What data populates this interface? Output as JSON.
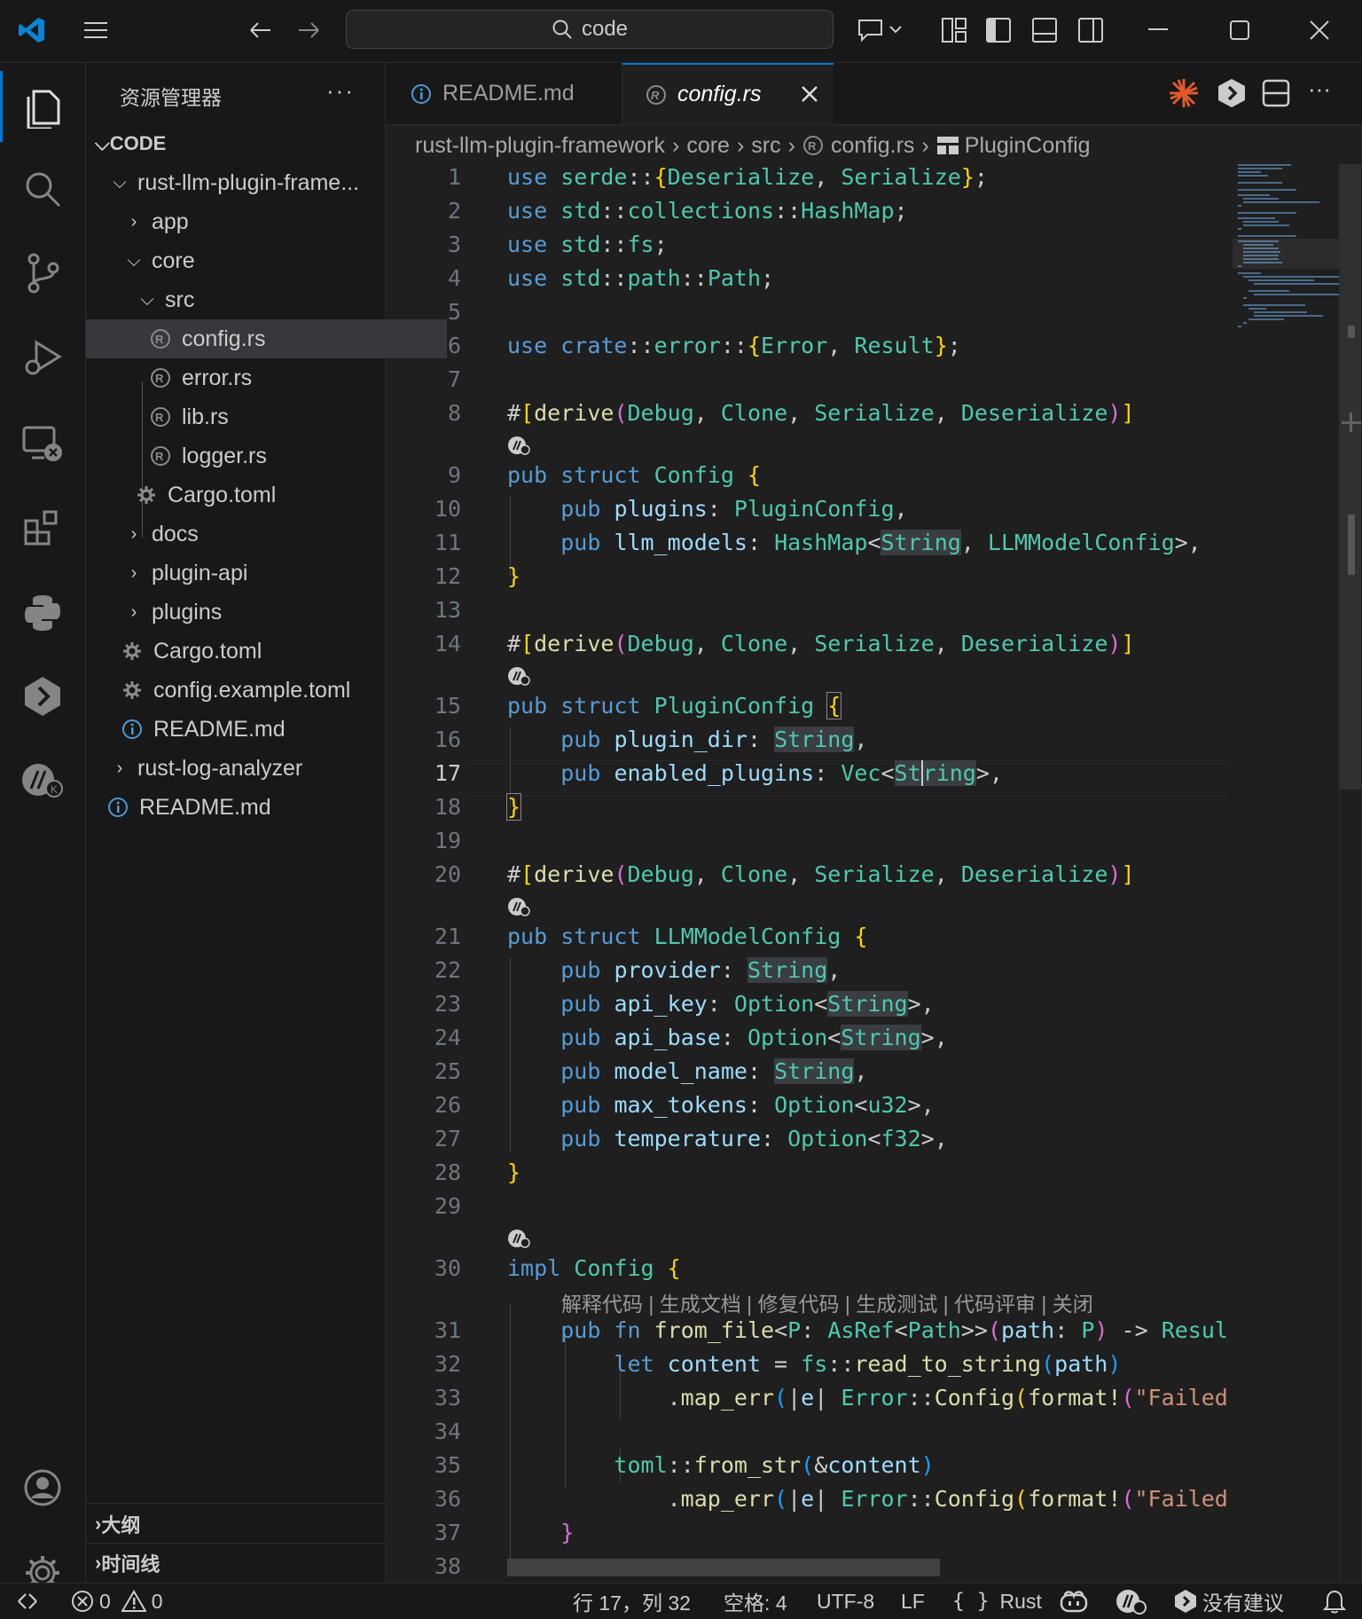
{
  "titlebar": {
    "search_text": "code"
  },
  "sidebar": {
    "title": "资源管理器",
    "more": "···",
    "root": "CODE",
    "tree": [
      {
        "label": "rust-llm-plugin-frame...",
        "kind": "folder-open"
      },
      {
        "label": "app",
        "kind": "folder"
      },
      {
        "label": "core",
        "kind": "folder-open"
      },
      {
        "label": "src",
        "kind": "folder-open"
      },
      {
        "label": "config.rs",
        "kind": "rust",
        "selected": true
      },
      {
        "label": "error.rs",
        "kind": "rust"
      },
      {
        "label": "lib.rs",
        "kind": "rust"
      },
      {
        "label": "logger.rs",
        "kind": "rust"
      },
      {
        "label": "Cargo.toml",
        "kind": "gear"
      },
      {
        "label": "docs",
        "kind": "folder"
      },
      {
        "label": "plugin-api",
        "kind": "folder"
      },
      {
        "label": "plugins",
        "kind": "folder"
      },
      {
        "label": "Cargo.toml",
        "kind": "gear"
      },
      {
        "label": "config.example.toml",
        "kind": "gear"
      },
      {
        "label": "README.md",
        "kind": "info"
      },
      {
        "label": "rust-log-analyzer",
        "kind": "folder"
      },
      {
        "label": "README.md",
        "kind": "info"
      }
    ],
    "outline": "大纲",
    "timeline": "时间线"
  },
  "tabs": [
    {
      "label": "README.md",
      "active": false
    },
    {
      "label": "config.rs",
      "active": true
    }
  ],
  "breadcrumb": [
    "rust-llm-plugin-framework",
    "core",
    "src",
    "config.rs",
    "PluginConfig"
  ],
  "editor": {
    "codelens": "解释代码 | 生成文档 | 修复代码 | 生成测试 | 代码评审 | 关闭",
    "current_line": 17
  },
  "status": {
    "errors": "0",
    "warnings": "0",
    "position": "行 17，列 32",
    "indent": "空格: 4",
    "encoding": "UTF-8",
    "eol": "LF",
    "language": "Rust",
    "suggestion": "没有建议"
  },
  "colors": {
    "accent": "#0078d4",
    "keyword": "#569cd6",
    "type": "#4ec9b0",
    "field": "#9cdcfe"
  }
}
